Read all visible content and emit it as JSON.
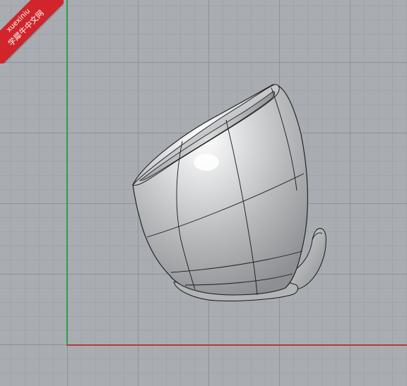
{
  "viewport": {
    "background": "#a9adb1",
    "grid_color": "#8c9095",
    "x_axis_color": "#b23b3b",
    "y_axis_color": "#2f9a4a"
  },
  "model": {
    "shape": "tilted-pot-surface",
    "surface_color": "#c9cacb",
    "edge_color": "#1a1a1a"
  },
  "watermark": {
    "site": "xuexiniu",
    "site_cn": "学犀牛中文网",
    "color": "#d1242b"
  }
}
